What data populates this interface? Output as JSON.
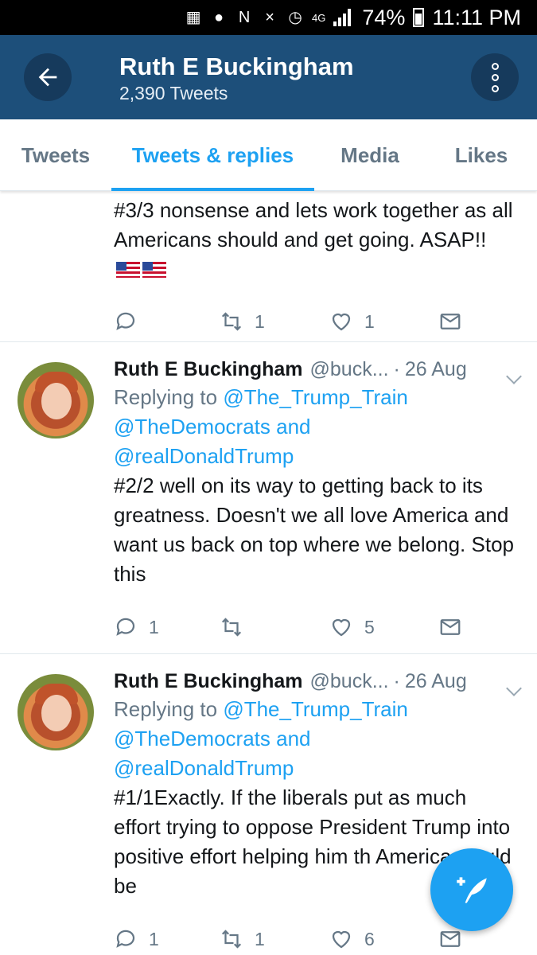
{
  "status_bar": {
    "battery": "74%",
    "time": "11:11 PM",
    "network": "4G"
  },
  "header": {
    "title": "Ruth E Buckingham",
    "subtitle": "2,390 Tweets",
    "back_icon": "arrow-left-icon",
    "more_icon": "more-vertical-icon",
    "color": "#1d4f7a"
  },
  "tabs": [
    {
      "label": "Tweets",
      "active": false
    },
    {
      "label": "Tweets & replies",
      "active": true
    },
    {
      "label": "Media",
      "active": false
    },
    {
      "label": "Likes",
      "active": false
    }
  ],
  "accent_color": "#1da1f2",
  "tweets": [
    {
      "text": "#3/3 nonsense and lets work together as all Americans should and get going. ASAP!!",
      "emoji": "US flag US flag",
      "reply_count": "",
      "retweet_count": "1",
      "like_count": "1"
    },
    {
      "name": "Ruth E Buckingham",
      "handle": "@buck...",
      "dot": "·",
      "date": "26 Aug",
      "replying_prefix": "Replying to ",
      "reply_line_1": "@The_Trump_Train",
      "reply_line_2": "@TheDemocrats and",
      "reply_line_3": "@realDonaldTrump",
      "text": "#2/2 well on its way to getting back to its greatness. Doesn't we all love America and want us back on top where we belong. Stop this",
      "reply_count": "1",
      "retweet_count": "",
      "like_count": "5"
    },
    {
      "name": "Ruth E Buckingham",
      "handle": "@buck...",
      "dot": "·",
      "date": "26 Aug",
      "replying_prefix": "Replying to ",
      "reply_line_1": "@The_Trump_Train",
      "reply_line_2": "@TheDemocrats and",
      "reply_line_3": "@realDonaldTrump",
      "text": "#1/1Exactly. If the liberals put as much effort trying to oppose President Trump into positive effort helping him  th America would be",
      "reply_count": "1",
      "retweet_count": "1",
      "like_count": "6"
    }
  ],
  "fab": {
    "icon": "compose-tweet-icon"
  }
}
